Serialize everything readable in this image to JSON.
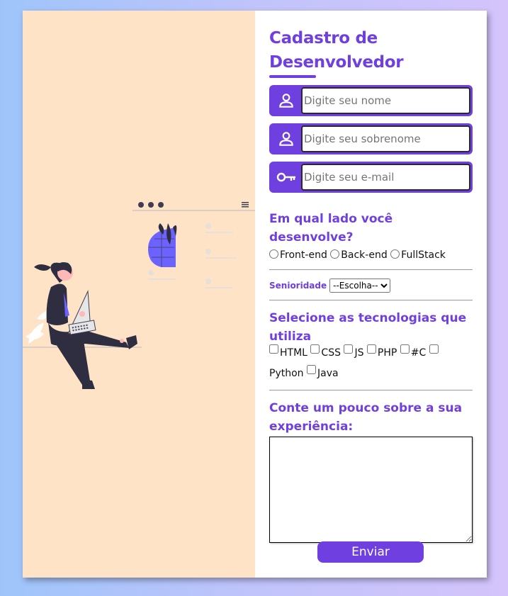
{
  "form": {
    "title": "Cadastro de Desenvolvedor",
    "fields": [
      {
        "icon": "user-icon",
        "placeholder": "Digite seu nome"
      },
      {
        "icon": "user-icon",
        "placeholder": "Digite seu sobrenome"
      },
      {
        "icon": "key-icon",
        "placeholder": "Digite seu e-mail"
      }
    ],
    "side_question": "Em qual lado você desenvolve?",
    "side_options": [
      "Front-end",
      "Back-end",
      "FullStack"
    ],
    "seniority_label": "Senioridade",
    "seniority_selected": "--Escolha--",
    "tech_question": "Selecione as tecnologias que utiliza",
    "tech_options": [
      "HTML",
      "CSS",
      "JS",
      "PHP",
      "#C",
      "Python",
      "Java"
    ],
    "experience_question": "Conte um pouco sobre a sua experiência:",
    "submit_label": "Enviar"
  },
  "colors": {
    "accent": "#6f3fe0",
    "illustration_bg": "#fee3c7",
    "background_gradient": [
      "#9ec5fb",
      "#d4c4fb"
    ]
  }
}
